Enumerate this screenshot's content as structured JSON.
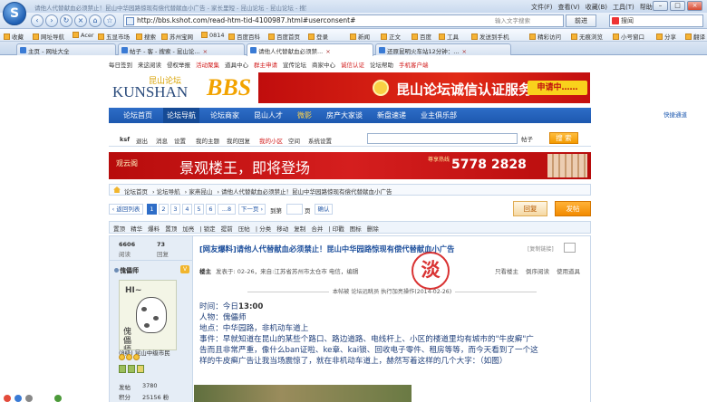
{
  "browser": {
    "logo_letter": "S",
    "title": "请他人代替献血必须禁止！昆山中华园路惊现有偿代替献血小广告 - 家长里短 - 昆山论坛 - 昆山论坛 - 搜狗高速浏览器",
    "menu": [
      "文件(F)",
      "查看(V)",
      "收藏(B)",
      "工具(T)",
      "帮助(H)"
    ],
    "url": "http://bbs.kshot.com/read-htm-tid-4100987.html#userconsent#",
    "url_hint": "输入文字搜索",
    "go_label": "前进",
    "search_value": "搜闻",
    "favorites": [
      "收藏",
      "网址导航",
      "Acer",
      "五显市场",
      "搜索",
      "苏州宝网",
      "0814",
      "百度百科",
      "百度首页",
      "用户登录",
      "登录",
      "手机登录",
      "新浪",
      "凤凰网",
      "新闻",
      "正文",
      "百度",
      "工具",
      "发送到手机",
      "精彩访问",
      "无痕浏览",
      "小号窗口",
      "分享",
      "翻译"
    ],
    "tabs": [
      {
        "label": "主页 - 网址大全",
        "active": false
      },
      {
        "label": "帖子 - 客 - 搜索 - 昆山论...",
        "active": false
      },
      {
        "label": "请他人代替献血必须禁...",
        "active": true
      },
      {
        "label": "还原昆明火车站12分钟：...",
        "active": false
      }
    ]
  },
  "site": {
    "topnav": [
      "每日签到",
      "来这阅读",
      "侵权举报",
      "活动聚集",
      "道具中心",
      "群主申请",
      "宣传论坛",
      "商家中心",
      "诚信认证",
      "论坛帮助",
      "手机客户端"
    ],
    "logo_latin": "KUNSHAN",
    "logo_bbs": "BBS",
    "logo_cn": "昆山论坛",
    "banner1_text": "昆山论坛诚信认证服务",
    "banner1_badge": "申请中……",
    "mainnav": [
      "论坛首页",
      "论坛导航",
      "论坛商家",
      "昆山人才",
      "微影",
      "房产大家谈",
      "新盘速递",
      "业主俱乐部"
    ],
    "quick_label": "快捷通道",
    "user_links": [
      "ksf",
      "退出",
      "消息",
      "设置",
      "我的主题",
      "我的回复",
      "我的小区",
      "空间",
      "系统设置"
    ],
    "search_type": "帖子",
    "search_btn": "搜 索",
    "banner2": {
      "logo": "观云阁",
      "headline": "景观楼王，即将登场",
      "hotline_label": "尊享热线",
      "phone": "5778 2828"
    },
    "breadcrumb": [
      "论坛首页",
      "论坛导航",
      "家燕昆山",
      "请他人代替献血必须禁止！昆山中华园路惊现有偿代替献血小广告"
    ]
  },
  "pager": {
    "prev": "‹ 返回列表",
    "pages": [
      "1",
      "2",
      "3",
      "4",
      "5",
      "6",
      "...8",
      "下一页 ›"
    ],
    "goto_label": "到第",
    "goto_unit": "页",
    "confirm": "确认",
    "reply": "回复",
    "post": "发帖"
  },
  "mod_tools": [
    "置顶",
    "精华",
    "爆料",
    "置顶",
    "加亮",
    "锁定",
    "提前",
    "压帖",
    "分类",
    "移动",
    "复制",
    "合并",
    "印戳",
    "图标",
    "删除"
  ],
  "thread": {
    "views": "6606",
    "views_label": "阅读",
    "replies": "73",
    "replies_label": "回复",
    "author": "傀儡师",
    "level_badge": "V",
    "avatar_hi": "HI~",
    "avatar_text": "傀儡师",
    "user_group": "(8级) 昆山中级市民",
    "post_count_label": "发帖",
    "post_count": "3780",
    "points_label": "积分",
    "points": "25156 粉",
    "title": "[网友爆料]请他人代替献血必须禁止！昆山中华园路惊现有偿代替献血小广告",
    "copy_link": "[复制链接]",
    "floor": "楼主",
    "meta": "发表于: 02-26，来自:江苏省苏州市太仓市 电信，编辑",
    "only_op": "只看楼主",
    "reverse": "倒序阅读",
    "mobile": "使用道具",
    "stamp": "淡",
    "mod_note": "本帖被 论坛远眺员 执行加亮操作(2014-02-26)",
    "body_lines": [
      {
        "label": "时间：",
        "text": "今日",
        "bold": "13:00"
      },
      {
        "label": "人物：",
        "text": "傀儡师",
        "bold": ""
      },
      {
        "label": "地点：",
        "text": "中华园路，非机动车道上",
        "bold": ""
      },
      {
        "label": "事件：",
        "text": "早就知道在昆山的某些个路口、路边道路、电线杆上、小区的楼道里均有城市的\"牛皮癣\"广",
        "bold": ""
      },
      {
        "label": "",
        "text": "告而且非常严重，像什么ban证啦、ke章、kai锁、回收电子零件、租房等等，而今天看到了一个这",
        "bold": ""
      },
      {
        "label": "",
        "text": "样的牛皮癣广告让我当场震惊了，就在非机动车道上，赫然写着这样的几个大字：（如图）",
        "bold": ""
      }
    ]
  },
  "colors": {
    "nav_blue": "#1c58af",
    "banner_red": "#d51e1e",
    "accent_orange": "#f28a00",
    "title_blue": "#1d4f9c"
  }
}
